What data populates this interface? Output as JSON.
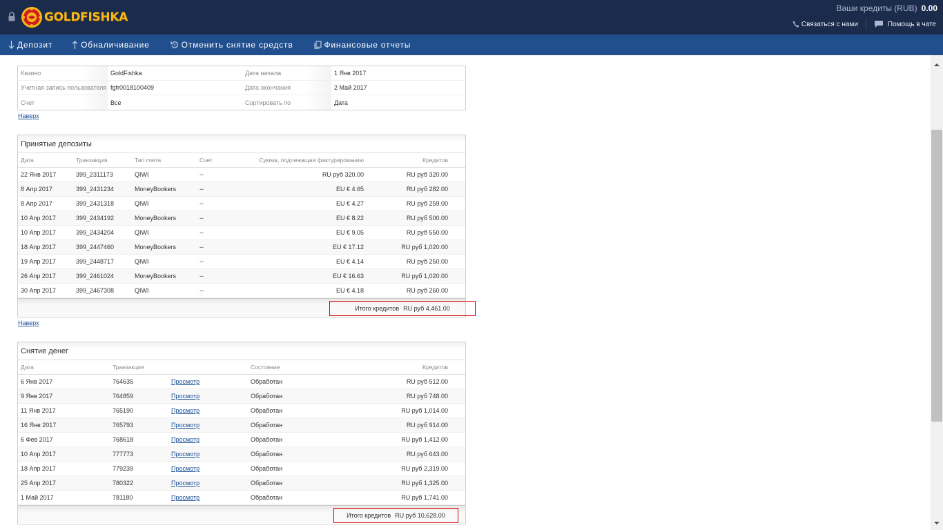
{
  "header": {
    "brand": "GOLDFISHKA",
    "credits_label": "Ваши кредиты (RUB)",
    "credits_value": "0.00",
    "contact_label": "Связаться с нами",
    "chat_label": "Помощь в чате"
  },
  "nav": {
    "items": [
      {
        "label": "Депозит",
        "icon": "arrow-down-icon"
      },
      {
        "label": "Обналичивание",
        "icon": "arrow-up-icon"
      },
      {
        "label": "Отменить снятие средств",
        "icon": "undo-icon"
      },
      {
        "label": "Финансовые отчеты",
        "icon": "copy-icon"
      }
    ]
  },
  "filter": {
    "rows": [
      {
        "l1": "Казино",
        "v1": "GoldFishka",
        "l2": "Дата начала",
        "v2": "1 Янв 2017"
      },
      {
        "l1": "Учетная запись пользователя",
        "v1": "fgfr0018100409",
        "l2": "Дата окончания",
        "v2": "2 Май 2017"
      },
      {
        "l1": "Счет",
        "v1": "Все",
        "l2": "Сортировать по",
        "v2": "Дата"
      }
    ]
  },
  "top_link": "Наверх",
  "deposits": {
    "title": "Принятые депозиты",
    "columns": [
      "Дата",
      "Транзакция",
      "Тип счета",
      "Счет",
      "Сумма, подлежащая фактурированию",
      "Кредитов"
    ],
    "rows": [
      [
        "22 Янв 2017",
        "399_2311173",
        "QIWI",
        "--",
        "RU руб 320.00",
        "RU руб 320.00"
      ],
      [
        "8 Апр 2017",
        "399_2431234",
        "MoneyBookers",
        "--",
        "EU € 4.65",
        "RU руб 282.00"
      ],
      [
        "8 Апр 2017",
        "399_2431318",
        "QIWI",
        "--",
        "EU € 4.27",
        "RU руб 259.00"
      ],
      [
        "10 Апр 2017",
        "399_2434192",
        "MoneyBookers",
        "--",
        "EU € 8.22",
        "RU руб 500.00"
      ],
      [
        "10 Апр 2017",
        "399_2434204",
        "QIWI",
        "--",
        "EU € 9.05",
        "RU руб 550.00"
      ],
      [
        "18 Апр 2017",
        "399_2447460",
        "MoneyBookers",
        "--",
        "EU € 17.12",
        "RU руб 1,020.00"
      ],
      [
        "19 Апр 2017",
        "399_2448717",
        "QIWI",
        "--",
        "EU € 4.14",
        "RU руб 250.00"
      ],
      [
        "26 Апр 2017",
        "399_2461024",
        "MoneyBookers",
        "--",
        "EU € 16.63",
        "RU руб 1,020.00"
      ],
      [
        "30 Апр 2017",
        "399_2467308",
        "QIWI",
        "--",
        "EU € 4.18",
        "RU руб 260.00"
      ]
    ],
    "total_label": "Итого кредитов",
    "total_value": "RU руб 4,461.00"
  },
  "withdrawals": {
    "title": "Снятие денег",
    "columns": [
      "Дата",
      "Транзакция",
      "",
      "Состояние",
      "Кредитов"
    ],
    "view_label": "Просмотр",
    "rows": [
      [
        "6 Янв 2017",
        "764635",
        "Обработан",
        "RU руб 512.00"
      ],
      [
        "9 Янв 2017",
        "764859",
        "Обработан",
        "RU руб 748.00"
      ],
      [
        "11 Янв 2017",
        "765190",
        "Обработан",
        "RU руб 1,014.00"
      ],
      [
        "16 Янв 2017",
        "765793",
        "Обработан",
        "RU руб 914.00"
      ],
      [
        "6 Фев 2017",
        "768618",
        "Обработан",
        "RU руб 1,412.00"
      ],
      [
        "10 Апр 2017",
        "777773",
        "Обработан",
        "RU руб 643.00"
      ],
      [
        "18 Апр 2017",
        "779239",
        "Обработан",
        "RU руб 2,319.00"
      ],
      [
        "25 Апр 2017",
        "780322",
        "Обработан",
        "RU руб 1,325.00"
      ],
      [
        "1 Май 2017",
        "781180",
        "Обработан",
        "RU руб 1,741.00"
      ]
    ],
    "total_label": "Итого кредитов",
    "total_value": "RU руб 10,628.00"
  }
}
